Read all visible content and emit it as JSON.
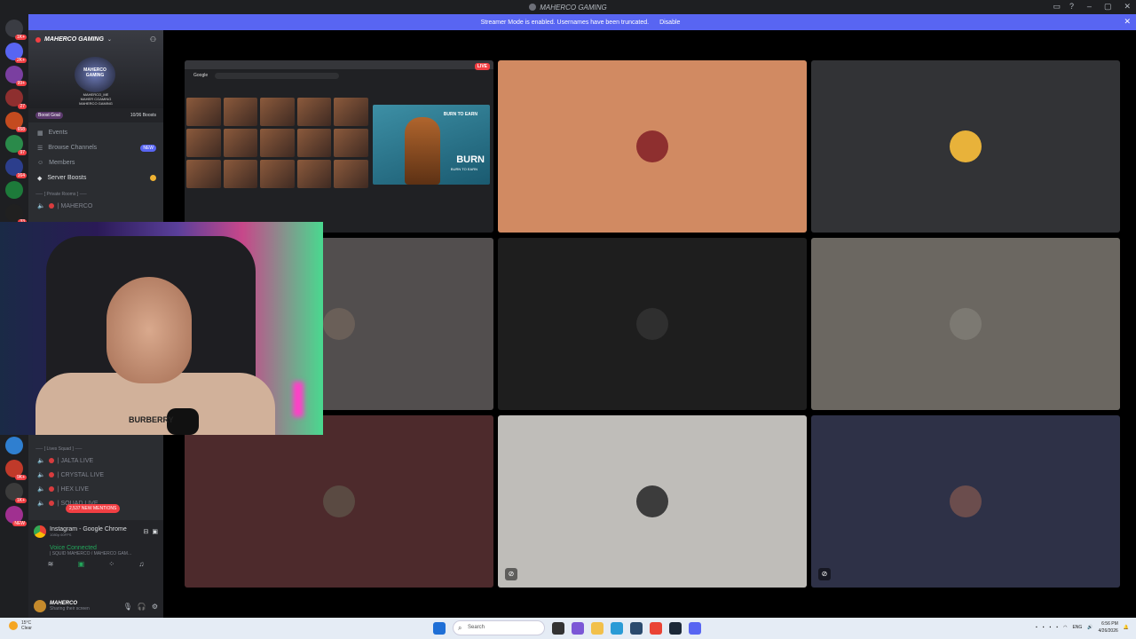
{
  "window": {
    "title": "MAHERCO GAMING"
  },
  "banner": {
    "text": "Streamer Mode is enabled. Usernames have been truncated.",
    "action": "Disable"
  },
  "server_rail": {
    "items": [
      {
        "badge": "1K+",
        "color": "#3a3c43"
      },
      {
        "badge": "2K+",
        "color": "#5865f2"
      },
      {
        "badge": "99+",
        "color": "#7a3fa0"
      },
      {
        "badge": "27",
        "color": "#8e2f2f"
      },
      {
        "badge": "658",
        "color": "#c44b1f"
      },
      {
        "badge": "97",
        "color": "#2a8a4a"
      },
      {
        "badge": "164",
        "color": "#2c3e8c"
      },
      {
        "badge": "",
        "color": "#1d7a3a"
      },
      {
        "badge": "33",
        "color": "#202020"
      },
      {
        "badge": "",
        "color": "#cccccc"
      }
    ],
    "lower_items": [
      {
        "badge": "",
        "color": "#2f7fd0"
      },
      {
        "badge": "9K+",
        "color": "#c03a2a"
      },
      {
        "badge": "1K+",
        "color": "#3b3b3b"
      },
      {
        "badge": "NEW",
        "color": "#a03090"
      }
    ]
  },
  "sidebar": {
    "server_name": "MAHERCO GAMING",
    "logo_text": "MAHERCO GAMING",
    "logo_lines": [
      "MAHERCO_ME",
      "MAHER CGAMING",
      "MAHERCO GAMING"
    ],
    "boost_goal": "Boost Goal",
    "boost_count": "10/36 Boosts",
    "nav": [
      {
        "label": "Events",
        "icon": "calendar-icon"
      },
      {
        "label": "Browse Channels",
        "icon": "browse-icon",
        "badge": "NEW"
      },
      {
        "label": "Members",
        "icon": "members-icon"
      },
      {
        "label": "Server Boosts",
        "icon": "boost-icon"
      }
    ],
    "category_private": "⸺ [ Private Rooms ] ⸺",
    "private_channels": [
      "| MAHERCO"
    ],
    "category_lives": "⸺ [ Lives Squad ] ⸺",
    "live_channels": [
      "| JALTA LIVE",
      "| CRYSTAL LIVE",
      "| HEX LIVE",
      "| SQUAD LIVE"
    ],
    "mentions": "2,537 NEW MENTIONS"
  },
  "activity_panel": {
    "app_name": "Instagram - Google Chrome",
    "app_sub": "1080p 60FPS",
    "voice_status": "Voice Connected",
    "voice_channel": "| SQUID MAHERCO / MAHERCO GAM...",
    "user_name": "MAHERCO",
    "user_status": "Sharing their screen"
  },
  "stream": {
    "live_label": "LIVE",
    "google_label": "Google",
    "promo_top": "BURN TO EARN",
    "promo_burn": "BURN",
    "promo_sub": "BURN TO EARN"
  },
  "webcam": {
    "shirt_text": "BURBERRY"
  },
  "tiles": [
    {
      "color": "#d18a62",
      "avatar": "#8e2f2f",
      "muted": false
    },
    {
      "color": "#323336",
      "avatar": "#e8b23a",
      "muted": false
    },
    {
      "color": "#524e4e",
      "avatar": "#6a5f58",
      "muted": false
    },
    {
      "color": "#1e1e1e",
      "avatar": "#2f2f2f",
      "muted": false
    },
    {
      "color": "#6b6761",
      "avatar": "#7c7972",
      "muted": false
    },
    {
      "color": "#4d2a2c",
      "avatar": "#5a4a42",
      "muted": false
    },
    {
      "color": "#bfbdb9",
      "avatar": "#3c3c3c",
      "muted": true
    },
    {
      "color": "#2e3147",
      "avatar": "#6b4d4d",
      "muted": true
    }
  ],
  "taskbar": {
    "temperature": "15°C",
    "weather": "Clear",
    "search_placeholder": "Search",
    "language": "ENG",
    "time": "6:56 PM",
    "date": "4/26/2026"
  }
}
